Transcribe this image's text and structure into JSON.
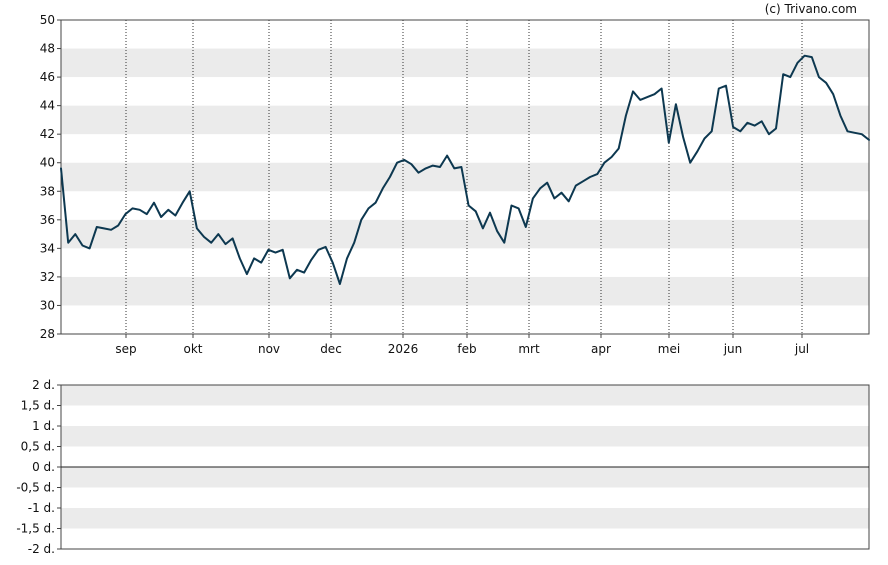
{
  "credit": "(c) Trivano.com",
  "chart_data": [
    {
      "type": "line",
      "title": "",
      "xlabel": "",
      "ylabel": "",
      "ylim": [
        28,
        50
      ],
      "y_ticks": [
        "28",
        "30",
        "32",
        "34",
        "36",
        "38",
        "40",
        "42",
        "44",
        "46",
        "48",
        "50"
      ],
      "x_tick_labels": [
        "sep",
        "okt",
        "nov",
        "dec",
        "2026",
        "feb",
        "mrt",
        "apr",
        "mei",
        "jun",
        "jul"
      ],
      "grid": "dotted vertical lines at month starts, alternating horizontal bands",
      "line_color": "#0d3850",
      "band_color": "#ebebeb",
      "series": [
        {
          "values": [
            39.6,
            34.4,
            35.0,
            34.2,
            34.0,
            35.5,
            35.4,
            35.3,
            35.6,
            36.4,
            36.8,
            36.7,
            36.4,
            37.2,
            36.2,
            36.7,
            36.3,
            37.2,
            38.0,
            35.4,
            34.8,
            34.4,
            35.0,
            34.3,
            34.7,
            33.3,
            32.2,
            33.3,
            33.0,
            33.9,
            33.7,
            33.9,
            31.9,
            32.5,
            32.3,
            33.2,
            33.9,
            34.1,
            33.0,
            31.5,
            33.3,
            34.4,
            36.0,
            36.8,
            37.2,
            38.2,
            39.0,
            40.0,
            40.2,
            39.9,
            39.3,
            39.6,
            39.8,
            39.7,
            40.5,
            39.6,
            39.7,
            37.0,
            36.6,
            35.4,
            36.5,
            35.2,
            34.4,
            37.0,
            36.8,
            35.5,
            37.5,
            38.2,
            38.6,
            37.5,
            37.9,
            37.3,
            38.4,
            38.7,
            39.0,
            39.2,
            40.0,
            40.4,
            41.0,
            43.3,
            45.0,
            44.4,
            44.6,
            44.8,
            45.2,
            41.4,
            44.1,
            41.8,
            40.0,
            40.8,
            41.7,
            42.2,
            45.2,
            45.4,
            42.5,
            42.2,
            42.8,
            42.6,
            42.9,
            42.0,
            42.4,
            46.2,
            46.0,
            47.0,
            47.5,
            47.4,
            46.0,
            45.6,
            44.8,
            43.3,
            42.2,
            42.1,
            42.0,
            41.6
          ]
        }
      ]
    },
    {
      "type": "line",
      "title": "",
      "xlabel": "",
      "ylabel": "",
      "ylim": [
        -2,
        2
      ],
      "y_ticks": [
        "2 d.",
        "1,5 d.",
        "1 d.",
        "0,5 d.",
        "0 d.",
        "-0,5 d.",
        "-1 d.",
        "-1,5 d.",
        "-2 d."
      ],
      "series": []
    }
  ]
}
